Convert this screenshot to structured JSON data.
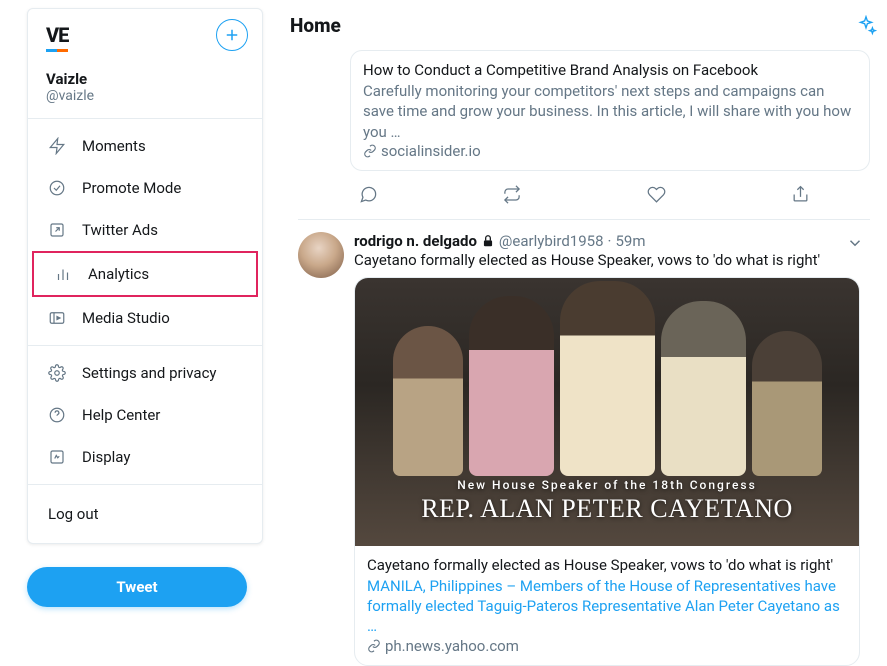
{
  "header": {
    "title": "Home"
  },
  "profile": {
    "name": "Vaizle",
    "handle": "@vaizle"
  },
  "menu": {
    "group1": [
      {
        "label": "Moments",
        "icon": "lightning-icon",
        "name": "menu-moments"
      },
      {
        "label": "Promote Mode",
        "icon": "promote-icon",
        "name": "menu-promote-mode"
      },
      {
        "label": "Twitter Ads",
        "icon": "external-icon",
        "name": "menu-twitter-ads"
      },
      {
        "label": "Analytics",
        "icon": "analytics-icon",
        "name": "menu-analytics",
        "highlight": true
      },
      {
        "label": "Media Studio",
        "icon": "media-icon",
        "name": "menu-media-studio"
      }
    ],
    "group2": [
      {
        "label": "Settings and privacy",
        "icon": "gear-icon",
        "name": "menu-settings"
      },
      {
        "label": "Help Center",
        "icon": "help-icon",
        "name": "menu-help"
      },
      {
        "label": "Display",
        "icon": "display-icon",
        "name": "menu-display"
      }
    ],
    "logout": "Log out"
  },
  "tweet_button": "Tweet",
  "card1": {
    "title": "How to Conduct a Competitive Brand Analysis on Facebook",
    "desc": "Carefully monitoring your competitors' next steps and campaigns can save time and grow your business. In this article, I will share with you how you …",
    "link": "socialinsider.io"
  },
  "tweet2": {
    "author": "rodrigo n. delgado",
    "handle": "@earlybird1958",
    "time": "59m",
    "text": "Cayetano formally elected as House Speaker, vows to 'do what is right'",
    "overlay_sub": "New House Speaker of the 18th Congress",
    "overlay_main": "REP. ALAN PETER CAYETANO",
    "card_title": "Cayetano formally elected as House Speaker, vows to 'do what is right'",
    "card_desc": "MANILA, Philippines – Members of the House of Representatives have formally elected Taguig-Pateros Representative Alan Peter Cayetano as …",
    "card_link": "ph.news.yahoo.com"
  }
}
